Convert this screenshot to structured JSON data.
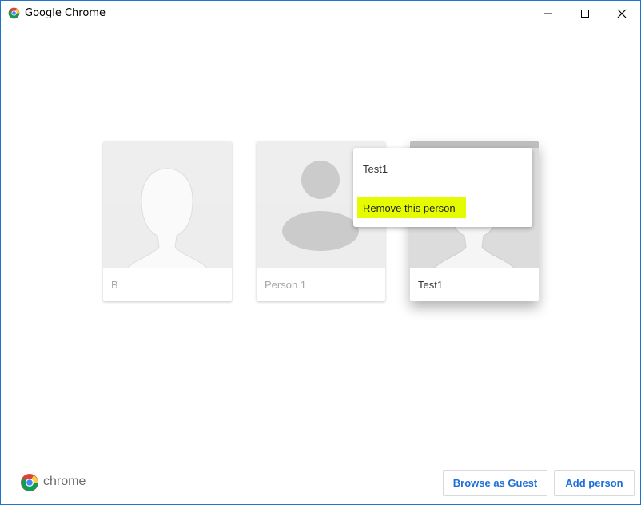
{
  "window": {
    "title": "Google Chrome",
    "controls": [
      "minimize-icon",
      "maximize-icon",
      "close-icon"
    ]
  },
  "profiles": [
    {
      "name": "B",
      "avatar": "mannequin-avatar-icon"
    },
    {
      "name": "Person 1",
      "avatar": "person-silhouette-icon"
    },
    {
      "name": "Test1",
      "avatar": "mannequin-avatar-icon"
    }
  ],
  "context_menu": {
    "title": "Test1",
    "items": [
      "Remove this person"
    ],
    "highlight_color": "#e5fb00"
  },
  "footer": {
    "logo_text": "chrome",
    "browse_guest_label": "Browse as Guest",
    "add_person_label": "Add person"
  },
  "colors": {
    "accent": "#1f6fd9",
    "window_border": "#1f74c9"
  }
}
